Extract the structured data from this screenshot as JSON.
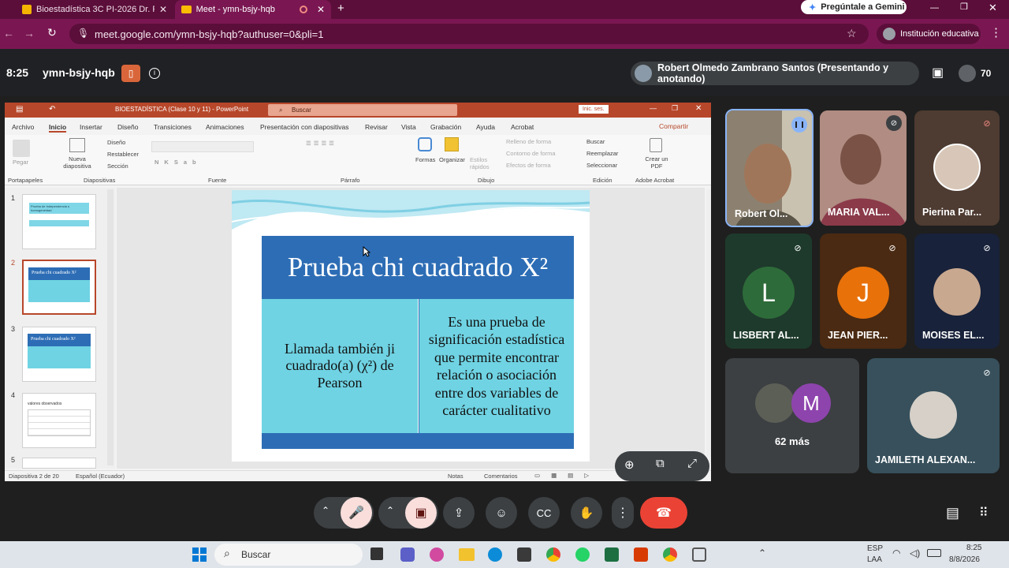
{
  "browser": {
    "tabs": [
      {
        "label": "Bioestadística 3C PI-2026 Dr. R",
        "active": false
      },
      {
        "label": "Meet - ymn-bsjy-hqb",
        "active": true
      }
    ],
    "gemini_label": "Pregúntale a Gemini",
    "url": "meet.google.com/ymn-bsjy-hqb?authuser=0&pli=1",
    "profile_label": "Institución educativa"
  },
  "meet": {
    "time": "8:25",
    "meeting_code": "ymn-bsjy-hqb",
    "presenter": "Robert Olmedo Zambrano Santos (Presentando y anotando)",
    "participant_count": "70",
    "others_label": "62 más"
  },
  "ppt": {
    "title": "BIOESTADÍSTICA (Clase 10 y 11) - PowerPoint",
    "search": "Buscar",
    "signin": "Inic. ses.",
    "menu": [
      "Archivo",
      "Inicio",
      "Insertar",
      "Diseño",
      "Transiciones",
      "Animaciones",
      "Presentación con diapositivas",
      "Revisar",
      "Vista",
      "Grabación",
      "Ayuda",
      "Acrobat"
    ],
    "share": "Compartir",
    "ribbon": {
      "pegar": "Pegar",
      "nueva": "Nueva diapositiva",
      "diseno": "Diseño",
      "restablecer": "Restablecer",
      "seccion": "Sección",
      "formas": "Formas",
      "organizar": "Organizar",
      "estilos": "Estilos rápidos",
      "relleno": "Relleno de forma",
      "contorno": "Contorno de forma",
      "efectos": "Efectos de forma",
      "buscar": "Buscar",
      "reemplazar": "Reemplazar",
      "seleccionar": "Seleccionar",
      "crear_pdf": "Crear un PDF",
      "groups": [
        "Portapapeles",
        "Diapositivas",
        "Fuente",
        "Párrafo",
        "Dibujo",
        "Edición",
        "Adobe Acrobat"
      ]
    },
    "slide": {
      "title": "Prueba chi cuadrado X²",
      "left": "Llamada también ji cuadrado(a) (χ²) de Pearson",
      "right": "Es una prueba de significación estadística que permite encontrar relación o asociación entre dos variables de carácter cualitativo"
    },
    "thumbs": [
      {
        "num": "1",
        "text": "Prueba de Independencia u homogeneidad"
      },
      {
        "num": "2",
        "text": "Prueba chi cuadrado X²"
      },
      {
        "num": "3",
        "text": "Prueba chi cuadrado X²"
      },
      {
        "num": "4",
        "text": "valores observados"
      },
      {
        "num": "5",
        "text": ""
      }
    ],
    "status": {
      "slide_count": "Diapositiva 2 de 20",
      "language": "Español (Ecuador)",
      "notes": "Notas",
      "comments": "Comentarios"
    }
  },
  "participants": [
    {
      "name": "Robert Ol...",
      "type": "video",
      "muted": false
    },
    {
      "name": "MARIA VAL...",
      "type": "video",
      "muted": true
    },
    {
      "name": "Pierina Par...",
      "type": "photo",
      "muted": true
    },
    {
      "name": "LISBERT AL...",
      "type": "letter",
      "letter": "L",
      "color": "#2e6b3a",
      "muted": true
    },
    {
      "name": "JEAN PIER...",
      "type": "letter",
      "letter": "J",
      "color": "#e8710a",
      "muted": true
    },
    {
      "name": "MOISES EL...",
      "type": "photo",
      "muted": true
    },
    {
      "name": "JAMILETH ALEXAN...",
      "type": "photo",
      "muted": true
    }
  ],
  "others_letter": "M",
  "taskbar": {
    "search": "Buscar",
    "lang": "ESP",
    "lang2": "LAA",
    "clock": "8:25",
    "date": "8/8/2026"
  },
  "colors": {
    "chrome_dark": "#5b0e3a",
    "chrome": "#7a1752",
    "ppt_red": "#b7472a",
    "end_call": "#ea4335",
    "slide_blue": "#2d6db5",
    "slide_cell": "#6fd3e3"
  }
}
